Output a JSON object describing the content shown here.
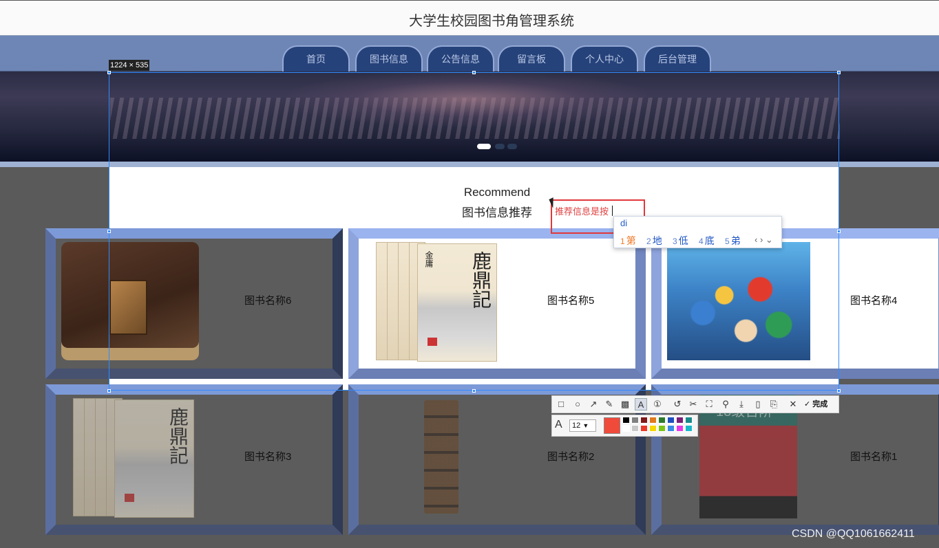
{
  "app": {
    "title": "大学生校园图书角管理系统"
  },
  "nav": {
    "tabs": [
      "首页",
      "图书信息",
      "公告信息",
      "留言板",
      "个人中心",
      "后台管理"
    ]
  },
  "capture": {
    "size_label": "1224 × 535"
  },
  "recommend": {
    "title_en": "Recommend",
    "title_cn": "图书信息推荐"
  },
  "books": [
    {
      "name": "图书名称6",
      "cover": "leather-book-cover"
    },
    {
      "name": "图书名称5",
      "cover": "boxset-cover"
    },
    {
      "name": "图书名称4",
      "cover": "anime-poster-cover"
    },
    {
      "name": "图书名称3",
      "cover": "boxset-cover"
    },
    {
      "name": "图书名称2",
      "cover": "tower-bookshelf-cover"
    },
    {
      "name": "图书名称1",
      "cover": "novel-cover"
    }
  ],
  "covers": {
    "boxset_title": "鹿鼎記",
    "boxset_series": "金庸",
    "novel_banner": "13级台阶"
  },
  "text_box": {
    "value": "推荐信息是按"
  },
  "ime": {
    "input": "di",
    "candidates": [
      {
        "num": "1",
        "text": "第"
      },
      {
        "num": "2",
        "text": "地"
      },
      {
        "num": "3",
        "text": "低"
      },
      {
        "num": "4",
        "text": "底"
      },
      {
        "num": "5",
        "text": "弟"
      }
    ],
    "nav": "‹ › ⌄"
  },
  "toolbar": {
    "done_label": "完成",
    "font_size": "12",
    "current_color": "#f04a3a",
    "icons": [
      "rectangle-icon",
      "ellipse-icon",
      "arrow-icon",
      "pencil-icon",
      "mosaic-icon",
      "text-icon",
      "serial-number-icon",
      "undo-icon",
      "scissors-icon",
      "ocr-icon",
      "pin-icon",
      "download-icon",
      "save-file-icon",
      "bookmark-icon",
      "close-icon",
      "check-icon"
    ]
  },
  "palette": [
    "#000000",
    "#808080",
    "#7f1a1a",
    "#e07a1f",
    "#2d7a2d",
    "#1f4fbf",
    "#7a1f7a",
    "#1a8a8a",
    "#ffffff",
    "#c8c8c8",
    "#e83a2a",
    "#f5d800",
    "#7ac41a",
    "#3a8ae8",
    "#e83ae8",
    "#1ab8c8"
  ],
  "watermark": "CSDN @QQ1061662411"
}
